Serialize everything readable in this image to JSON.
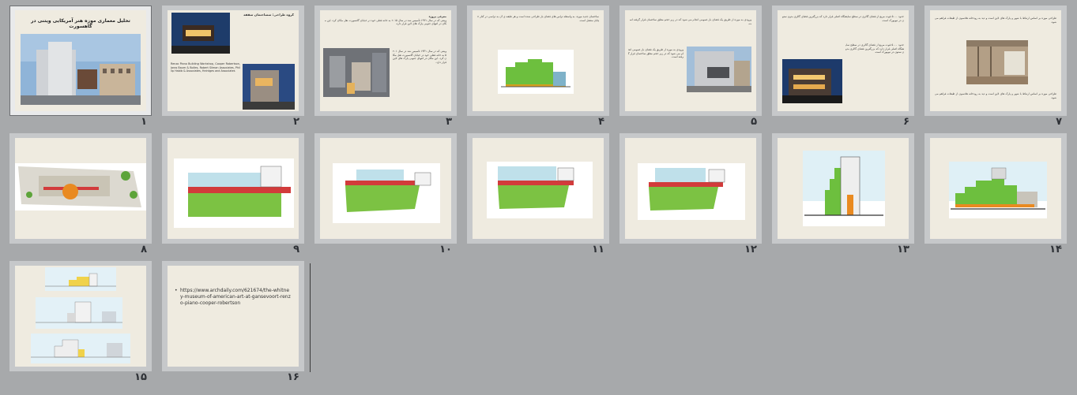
{
  "colors": {
    "pane_bg": "#a7a9ab",
    "slide_bg": "#efebe0",
    "green_roof": "#6dbf3e",
    "red_band": "#d23b3b",
    "blue_glass": "#7fb2c9"
  },
  "slides": [
    {
      "number": "۱",
      "title": "تحلیل معماری موزه هنر آمریکایی ویتنی در گاهسورت"
    },
    {
      "number": "۲",
      "title": "گروه طراحی: سساختمان سقفه",
      "text": "Renzo Piano Building Workshop, Cooper Robertson, Jaros Baum & Bolles, Robert Silman Associates, Phillip Habib & Associates, Heintges and Associates"
    },
    {
      "number": "۳",
      "title": "معرفی پروژه",
      "text": "ویتنی که در سال ۱۹۳۱ تأسیس شد در سال ۲۰۱۵ به خانه فعلی خود در خیابان گانسورت نقل مکان کرد. این مکان در انتهای جنوبی پارک های لاین قرار دارد."
    },
    {
      "number": "۴",
      "text": "ساختمان جدید موزه، به واسطه تراس های فضای باز طراحی شده است و هر طبقه ی آن به تراسی در کنار خیابان متصل است."
    },
    {
      "number": "۵",
      "text": "ورودی به موزه از طریق یک فضای باز عمومی انجام می شود که در زیر حجم معلق ساختمان قرار گرفته است."
    },
    {
      "number": "۶",
      "text": "حدود ۵۰۰۰ فوت مربع از فضای گالری در سطح نمایشگاه اصلی قرار دارد که بزرگترین فضای گالری بدون ستون در نیویورک است."
    },
    {
      "number": "۷",
      "text": "طراحی موزه بر اساس ارتباط با شهر و پارک های لاین است و دید به رودخانه هادسون از طبقات فراهم می شود."
    },
    {
      "number": "۸"
    },
    {
      "number": "۹"
    },
    {
      "number": "۱۰"
    },
    {
      "number": "۱۱"
    },
    {
      "number": "۱۲"
    },
    {
      "number": "۱۳"
    },
    {
      "number": "۱۴"
    },
    {
      "number": "۱۵"
    },
    {
      "number": "۱۶",
      "url": "https://www.archdaily.com/621674/the-whitney-museum-of-american-art-at-gansevoort-renzo-piano-cooper-robertson"
    }
  ]
}
